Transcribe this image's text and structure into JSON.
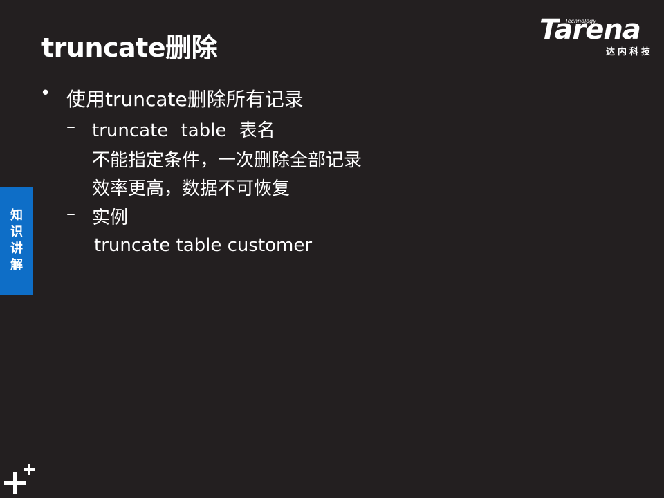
{
  "slide": {
    "title": "truncate删除"
  },
  "logo": {
    "tagline": "Technology",
    "wordmark": "Tarena",
    "cn_name": "达内科技"
  },
  "side_tab": {
    "label": "知\n识\n讲\n解"
  },
  "content": {
    "bullet_symbol": "•",
    "bullet_1": "使用truncate删除所有记录",
    "dash_symbol": "–",
    "sub_1_line_1": "truncate   table  表名",
    "sub_1_line_2": "不能指定条件，一次删除全部记录",
    "sub_1_line_3": "效率更高，数据不可恢复",
    "sub_2_label": "实例",
    "sub_2_example": "truncate table customer"
  },
  "colors": {
    "background": "#231f20",
    "side_tab": "#0e6ec7",
    "text": "#ffffff"
  },
  "icons": {
    "corner": "plus-plus-icon"
  }
}
